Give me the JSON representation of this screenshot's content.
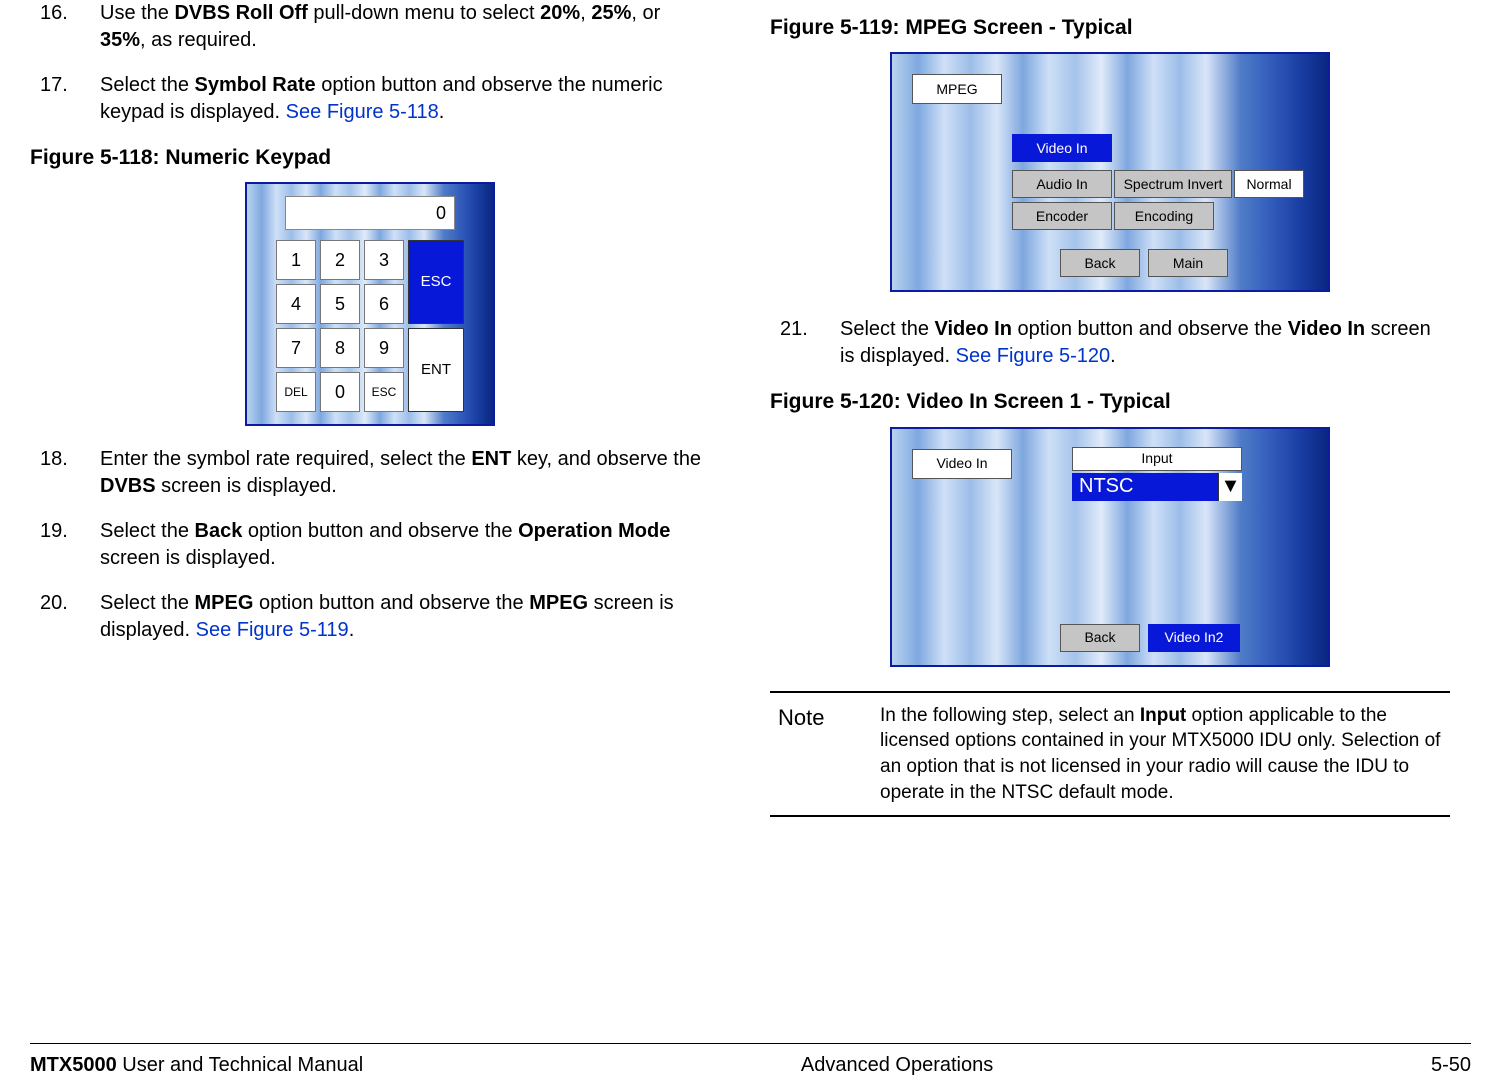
{
  "steps": {
    "s16": {
      "num": "16.",
      "body_pre": "Use the ",
      "b1": "DVBS Roll Off",
      "mid1": " pull-down menu to select ",
      "b2": "20%",
      "mid2": ", ",
      "b3": "25%",
      "mid3": ", or ",
      "b4": "35%",
      "tail": ", as required."
    },
    "s17": {
      "num": "17.",
      "body_pre": "Select the ",
      "b1": "Symbol Rate",
      "mid1": " option button and observe the numeric keypad is displayed.  ",
      "link": "See Figure 5-118",
      "tail": "."
    },
    "s18": {
      "num": "18.",
      "body_pre": "Enter the symbol rate required, select the ",
      "b1": "ENT",
      "mid1": " key, and observe the ",
      "b2": "DVBS",
      "tail": " screen is displayed."
    },
    "s19": {
      "num": "19.",
      "body_pre": "Select the ",
      "b1": "Back",
      "mid1": " option button and observe the ",
      "b2": "Operation Mode",
      "tail": " screen is displayed."
    },
    "s20": {
      "num": "20.",
      "body_pre": "Select the ",
      "b1": "MPEG",
      "mid1": " option button and observe the ",
      "b2": "MPEG",
      "mid2": " screen is displayed.  ",
      "link": "See Figure 5-119",
      "tail": "."
    },
    "s21": {
      "num": "21.",
      "body_pre": "Select the ",
      "b1": "Video In",
      "mid1": " option button and observe the ",
      "b2": "Video In",
      "mid2": " screen is displayed.  ",
      "link": "See Figure 5-120",
      "tail": "."
    }
  },
  "fig118": {
    "caption": "Figure 5-118:   Numeric Keypad",
    "display": "0",
    "keys": {
      "k1": "1",
      "k2": "2",
      "k3": "3",
      "k4": "4",
      "k5": "5",
      "k6": "6",
      "k7": "7",
      "k8": "8",
      "k9": "9",
      "del": "DEL",
      "k0": "0",
      "escS": "ESC",
      "escB": "ESC",
      "ent": "ENT"
    }
  },
  "fig119": {
    "caption": "Figure 5-119:   MPEG Screen - Typical",
    "labels": {
      "mpeg": "MPEG",
      "videoIn": "Video In",
      "audioIn": "Audio In",
      "specInv": "Spectrum Invert",
      "normal": "Normal",
      "encoder": "Encoder",
      "encoding": "Encoding",
      "back": "Back",
      "main": "Main"
    }
  },
  "fig120": {
    "caption": "Figure 5-120:   Video In Screen 1 - Typical",
    "labels": {
      "videoIn": "Video In",
      "input": "Input",
      "ntsc": "NTSC",
      "arrow": "▼",
      "back": "Back",
      "vidIn2": "Video In2"
    }
  },
  "note": {
    "label": "Note",
    "pre": "In the following step, select an ",
    "b1": "Input",
    "tail": " option applicable to the licensed options contained in your MTX5000 IDU only.  Selection of an option that is not licensed in your radio will cause the IDU to operate in the NTSC default mode."
  },
  "footer": {
    "left_b": "MTX5000",
    "left_rest": " User and Technical Manual",
    "center": "Advanced Operations",
    "right": "5-50"
  }
}
